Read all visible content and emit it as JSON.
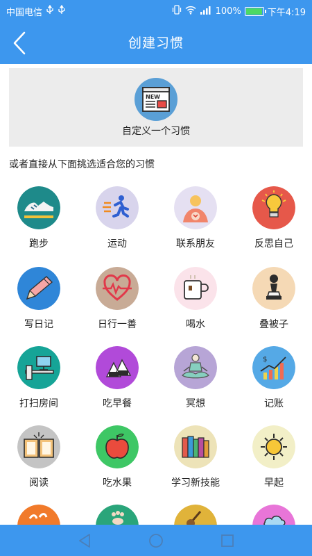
{
  "status_bar": {
    "carrier": "中国电信",
    "battery": "100%",
    "time": "下午4:19"
  },
  "header": {
    "title": "创建习惯"
  },
  "custom_habit": {
    "label": "自定义一个习惯",
    "icon_badge": "NEW"
  },
  "subtitle": "或者直接从下面挑选适合您的习惯",
  "habits": [
    {
      "label": "跑步",
      "icon": "running-shoe-icon",
      "color": "#1e8a8a"
    },
    {
      "label": "运动",
      "icon": "runner-icon",
      "color": "#d8d4ec"
    },
    {
      "label": "联系朋友",
      "icon": "phone-contact-icon",
      "color": "#e5e0f2"
    },
    {
      "label": "反思自己",
      "icon": "lightbulb-icon",
      "color": "#e6584a"
    },
    {
      "label": "写日记",
      "icon": "pencil-icon",
      "color": "#2f86d8"
    },
    {
      "label": "日行一善",
      "icon": "heartbeat-icon",
      "color": "#c8ab96"
    },
    {
      "label": "喝水",
      "icon": "mug-icon",
      "color": "#fbe3ea"
    },
    {
      "label": "叠被子",
      "icon": "chess-pawn-icon",
      "color": "#f5d9b5"
    },
    {
      "label": "打扫房间",
      "icon": "desk-icon",
      "color": "#16a497"
    },
    {
      "label": "吃早餐",
      "icon": "rice-ball-icon",
      "color": "#b14ad9"
    },
    {
      "label": "冥想",
      "icon": "meditation-icon",
      "color": "#b7a5d6"
    },
    {
      "label": "记账",
      "icon": "growth-chart-icon",
      "color": "#55a9e6"
    },
    {
      "label": "阅读",
      "icon": "open-book-icon",
      "color": "#c4c4c4"
    },
    {
      "label": "吃水果",
      "icon": "apple-icon",
      "color": "#3ec765"
    },
    {
      "label": "学习新技能",
      "icon": "books-icon",
      "color": "#ede3b8"
    },
    {
      "label": "早起",
      "icon": "sun-icon",
      "color": "#f2efc7"
    },
    {
      "label": "",
      "icon": "footprint-icon",
      "color": "#f17a2a"
    },
    {
      "label": "",
      "icon": "footprint-icon",
      "color": "#2aa57a"
    },
    {
      "label": "",
      "icon": "guitar-icon",
      "color": "#e0b33a"
    },
    {
      "label": "",
      "icon": "cloud-icon",
      "color": "#e875d8"
    }
  ]
}
